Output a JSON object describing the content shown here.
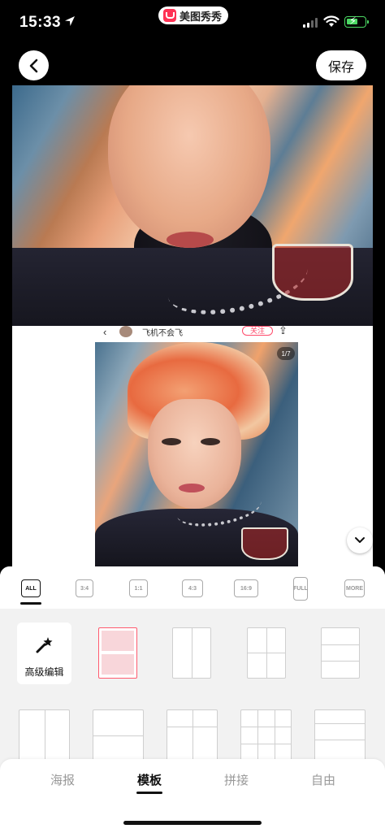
{
  "status_bar": {
    "time": "15:33",
    "app_name": "美图秀秀",
    "accent_battery": "#4cd964"
  },
  "header": {
    "save_label": "保存"
  },
  "canvas": {
    "strip": {
      "back": "‹",
      "user_name": "飞机不会飞",
      "follow_label": "关注",
      "share": "⇪"
    },
    "page_indicator": "1/7"
  },
  "ratios": [
    "ALL",
    "3:4",
    "1:1",
    "4:3",
    "16:9",
    "FULL",
    "MORE"
  ],
  "active_ratio": "ALL",
  "layouts": {
    "advanced_edit_label": "高级编辑"
  },
  "tabs": [
    {
      "label": "海报"
    },
    {
      "label": "模板"
    },
    {
      "label": "拼接"
    },
    {
      "label": "自由"
    }
  ],
  "active_tab": "模板",
  "colors": {
    "accent": "#ff5a6e",
    "panel_bg": "#f2f2f2"
  }
}
